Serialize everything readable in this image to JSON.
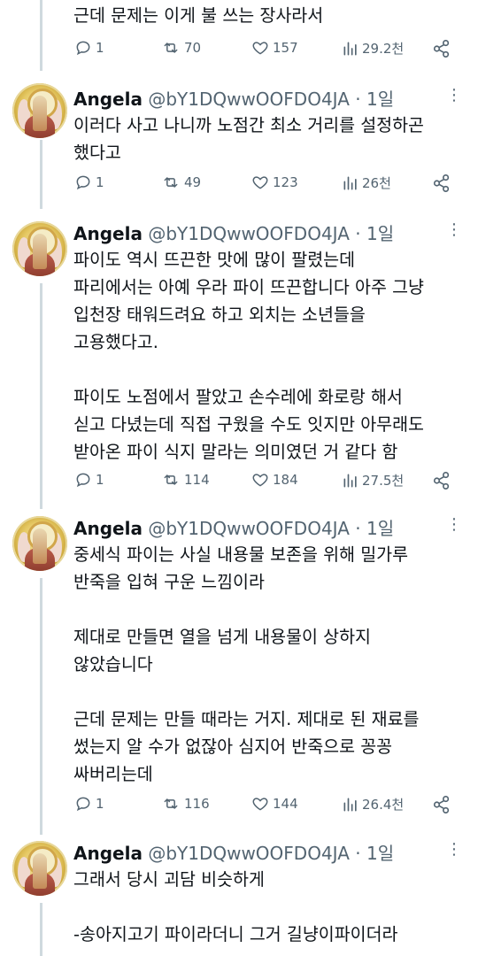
{
  "top": {
    "text": "근데 문제는 이게 불 쓰는 장사라서",
    "stats": {
      "replies": "1",
      "retweets": "70",
      "likes": "157",
      "views": "29.2천"
    }
  },
  "tweets": [
    {
      "name": "Angela",
      "handle": "@bY1DQwwOOFDO4JA",
      "time": "1일",
      "lines": [
        "이러다 사고 나니까 노점간 최소 거리를 설정하곤",
        "했다고"
      ],
      "stats": {
        "replies": "1",
        "retweets": "49",
        "likes": "123",
        "views": "26천"
      }
    },
    {
      "name": "Angela",
      "handle": "@bY1DQwwOOFDO4JA",
      "time": "1일",
      "lines": [
        "파이도 역시 뜨끈한 맛에 많이 팔렸는데",
        "파리에서는 아예 우라 파이 뜨끈합니다 아주 그냥",
        "입천장 태워드려요 하고 외치는 소년들을",
        "고용했다고.",
        "",
        "파이도 노점에서 팔았고 손수레에 화로랑 해서",
        "싣고 다녔는데 직접 구웠을 수도 잇지만 아무래도",
        "받아온 파이 식지 말라는 의미였던 거 같다 함"
      ],
      "stats": {
        "replies": "1",
        "retweets": "114",
        "likes": "184",
        "views": "27.5천"
      }
    },
    {
      "name": "Angela",
      "handle": "@bY1DQwwOOFDO4JA",
      "time": "1일",
      "lines": [
        "중세식 파이는 사실 내용물 보존을 위해 밀가루",
        "반죽을 입혀 구운 느낌이라",
        "",
        "제대로 만들면 열을 넘게 내용물이 상하지",
        "않았습니다",
        "",
        "근데 문제는 만들 때라는 거지. 제대로 된 재료를",
        "썼는지 알 수가 없잖아 심지어 반죽으로 꽁꽁",
        "싸버리는데"
      ],
      "stats": {
        "replies": "1",
        "retweets": "116",
        "likes": "144",
        "views": "26.4천"
      }
    },
    {
      "name": "Angela",
      "handle": "@bY1DQwwOOFDO4JA",
      "time": "1일",
      "lines": [
        "그래서 당시 괴담 비슷하게",
        "",
        "-송아지고기 파이라더니 그거 길냥이파이더라"
      ]
    }
  ]
}
